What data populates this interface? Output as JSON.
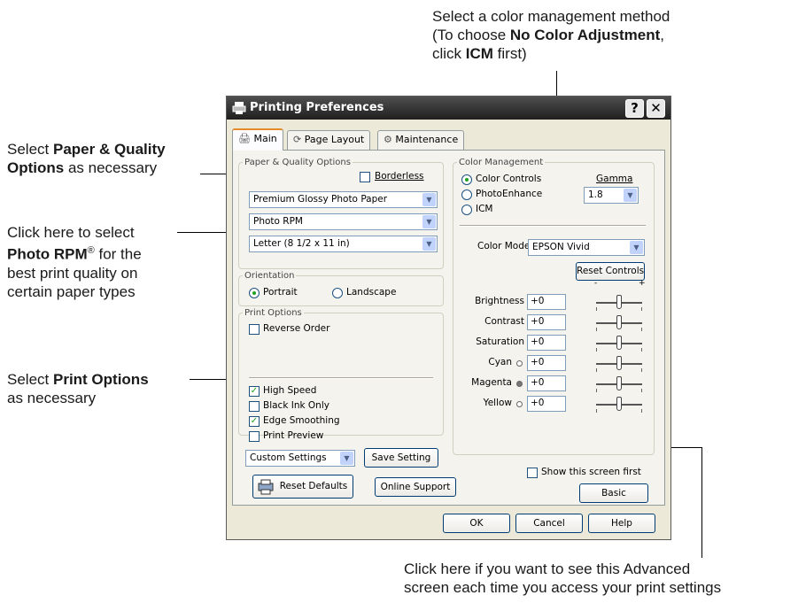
{
  "callouts": {
    "color_method": {
      "line1": "Select a color management method",
      "line2_pre": "(To choose ",
      "line2_bold": "No Color Adjustment",
      "line2_post": ",",
      "line3_pre": "click ",
      "line3_bold": "ICM",
      "line3_post": " first)"
    },
    "paper_quality": {
      "pre": "Select ",
      "bold1": "Paper & Quality",
      "bold2": "Options",
      "post": " as necessary"
    },
    "photo_rpm": {
      "line1": "Click here to select",
      "bold": "Photo RPM",
      "sup": "®",
      "post": " for the",
      "line3": "best print quality on",
      "line4": "certain paper types"
    },
    "print_options": {
      "pre": "Select ",
      "bold": "Print Options",
      "line2": "as necessary"
    },
    "show_screen": {
      "line1": "Click here if you want to see this Advanced",
      "line2": "screen each time you access your print settings"
    }
  },
  "window": {
    "title": "Printing Preferences",
    "help_btn": "?",
    "close_btn": "✕",
    "tabs": [
      "Main",
      "Page Layout",
      "Maintenance"
    ]
  },
  "paper_quality": {
    "legend": "Paper & Quality Options",
    "borderless": "Borderless",
    "borderless_checked": false,
    "paper_type": "Premium Glossy Photo Paper",
    "quality": "Photo RPM",
    "size": "Letter (8 1/2 x 11 in)"
  },
  "orientation": {
    "legend": "Orientation",
    "portrait": "Portrait",
    "landscape": "Landscape",
    "selected": "Portrait"
  },
  "print_options": {
    "legend": "Print Options",
    "reverse_order": "Reverse Order",
    "high_speed": "High Speed",
    "black_ink_only": "Black Ink Only",
    "edge_smoothing": "Edge Smoothing",
    "print_preview": "Print Preview",
    "checked": {
      "reverse_order": false,
      "high_speed": true,
      "black_ink_only": false,
      "edge_smoothing": true,
      "print_preview": false
    }
  },
  "bottom": {
    "custom_settings": "Custom Settings",
    "save_setting": "Save Setting",
    "reset_defaults": "Reset Defaults",
    "online_support": "Online Support"
  },
  "color_management": {
    "legend": "Color Management",
    "color_controls": "Color Controls",
    "photoenhance": "PhotoEnhance",
    "icm": "ICM",
    "selected": "Color Controls",
    "gamma_label": "Gamma",
    "gamma_value": "1.8",
    "color_mode_label": "Color Mode",
    "color_mode_value": "EPSON Vivid",
    "reset_controls": "Reset Controls",
    "slider_minus": "-",
    "slider_plus": "+",
    "adjustments": [
      {
        "label": "Brightness",
        "value": "+0",
        "level": 0.5,
        "dot": "none"
      },
      {
        "label": "Contrast",
        "value": "+0",
        "level": 0.5,
        "dot": "none"
      },
      {
        "label": "Saturation",
        "value": "+0",
        "level": 0.5,
        "dot": "none"
      },
      {
        "label": "Cyan",
        "value": "+0",
        "level": 0.5,
        "dot": "hollow"
      },
      {
        "label": "Magenta",
        "value": "+0",
        "level": 0.5,
        "dot": "filled"
      },
      {
        "label": "Yellow",
        "value": "+0",
        "level": 0.5,
        "dot": "hollow"
      }
    ]
  },
  "show_screen_first": "Show this screen first",
  "show_screen_first_checked": false,
  "basic_btn": "Basic",
  "footer": {
    "ok": "OK",
    "cancel": "Cancel",
    "help": "Help"
  },
  "colors": {
    "titlebar": "#2b2b2b",
    "check_green": "#21a121",
    "dialog_bg": "#ece9d8"
  }
}
